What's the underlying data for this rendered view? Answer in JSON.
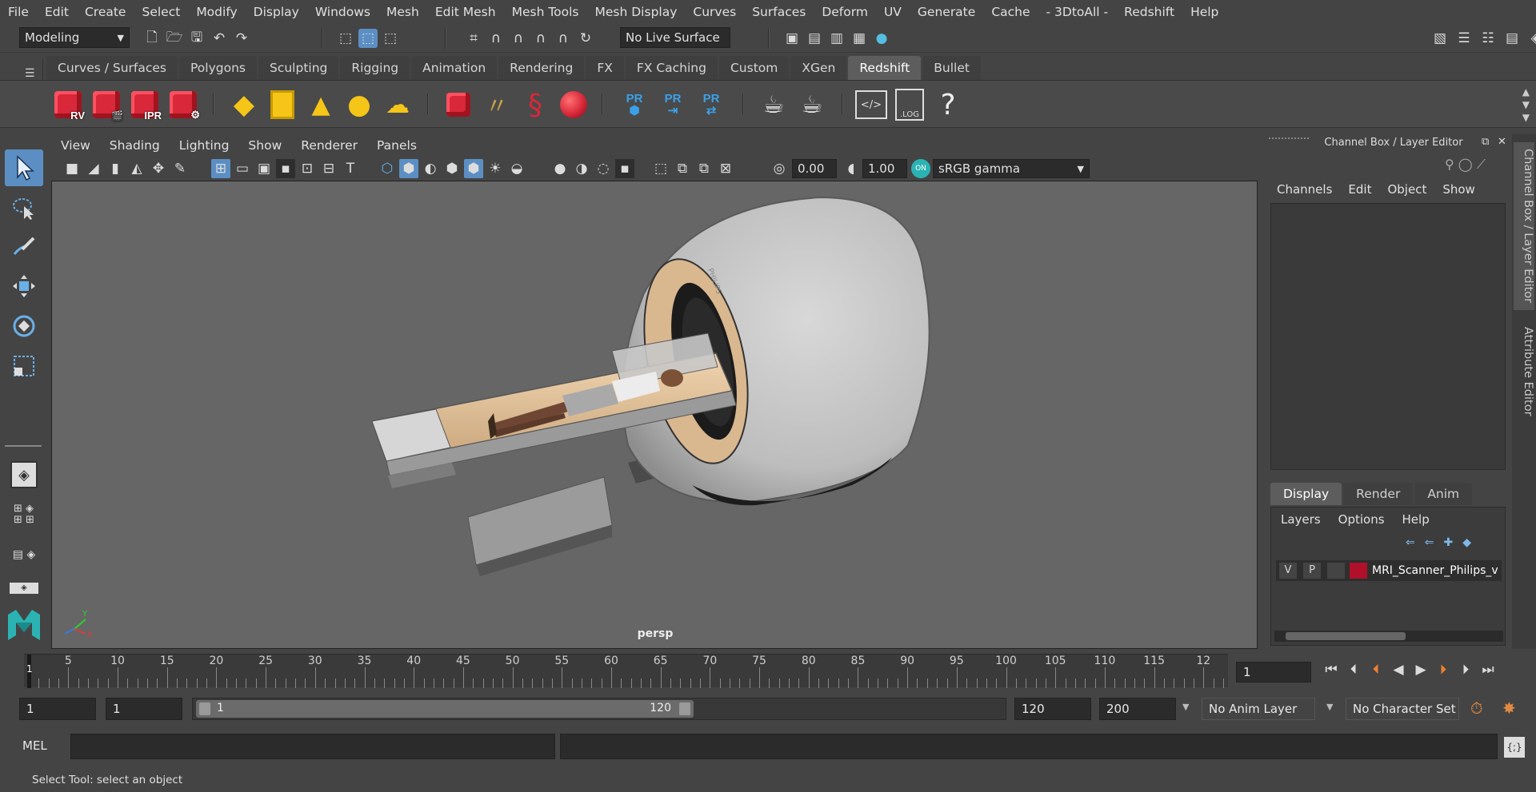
{
  "menubar": {
    "items": [
      "File",
      "Edit",
      "Create",
      "Select",
      "Modify",
      "Display",
      "Windows",
      "Mesh",
      "Edit Mesh",
      "Mesh Tools",
      "Mesh Display",
      "Curves",
      "Surfaces",
      "Deform",
      "UV",
      "Generate",
      "Cache",
      "- 3DtoAll -",
      "Redshift",
      "Help"
    ]
  },
  "statusline": {
    "workspace": "Modeling",
    "live_surface": "No Live Surface"
  },
  "shelf": {
    "tabs": [
      "Curves / Surfaces",
      "Polygons",
      "Sculpting",
      "Rigging",
      "Animation",
      "Rendering",
      "FX",
      "FX Caching",
      "Custom",
      "XGen",
      "Redshift",
      "Bullet"
    ],
    "active_tab": "Redshift",
    "rv_label": "RV",
    "ipr_label": "IPR",
    "pr_label": "PR",
    "log_label": ".LOG",
    "help_glyph": "?"
  },
  "viewport": {
    "menu": [
      "View",
      "Shading",
      "Lighting",
      "Show",
      "Renderer",
      "Panels"
    ],
    "exposure": "0.00",
    "gamma": "1.00",
    "colorspace": "sRGB gamma",
    "camera_label": "persp",
    "brand_text": "PHILIPS"
  },
  "channel_box": {
    "title": "Channel Box / Layer Editor",
    "menu": [
      "Channels",
      "Edit",
      "Object",
      "Show"
    ],
    "layer_tabs": [
      "Display",
      "Render",
      "Anim"
    ],
    "active_layer_tab": "Display",
    "layer_menu": [
      "Layers",
      "Options",
      "Help"
    ],
    "layer": {
      "v": "V",
      "p": "P",
      "name": "MRI_Scanner_Philips_v",
      "color": "#b0102a"
    }
  },
  "side_tabs": [
    "Channel Box / Layer Editor",
    "Attribute Editor"
  ],
  "timeline": {
    "labels": [
      "5",
      "10",
      "15",
      "20",
      "25",
      "30",
      "35",
      "40",
      "45",
      "50",
      "55",
      "60",
      "65",
      "70",
      "75",
      "80",
      "85",
      "90",
      "95",
      "100",
      "105",
      "110",
      "115",
      "12"
    ],
    "current_frame_marker": "1",
    "current_frame": "1"
  },
  "range": {
    "start": "1",
    "playback_start": "1",
    "slider_start": "1",
    "slider_end": "120",
    "playback_end": "120",
    "end": "200",
    "anim_layer": "No Anim Layer",
    "character_set": "No Character Set"
  },
  "cmd": {
    "label": "MEL"
  },
  "help_line": "Select Tool: select an object",
  "colors": {
    "accent": "#5b8fc4",
    "redshift_red": "#d8283a",
    "yellow": "#f5c518",
    "pr_blue": "#3aa0e8"
  }
}
